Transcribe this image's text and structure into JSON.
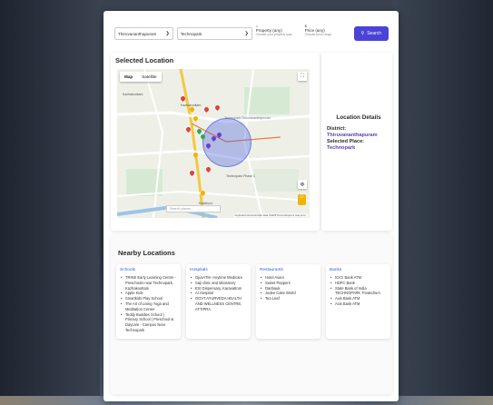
{
  "search": {
    "district": "Thiruvananthapuram",
    "place": "Technopark",
    "property_title": "Property (any)",
    "property_hint": "Choose your property type",
    "price_title": "Price (any)",
    "price_hint": "Choose price range",
    "search_label": "Search"
  },
  "map_section": {
    "title": "Selected Location",
    "tabs": [
      "Map",
      "Satellite"
    ],
    "search_placeholder": "Search places...",
    "footer": "Keyboard shortcuts  Map data ©2025  Terms  Report a map error",
    "labels": [
      "Kazhakoottam",
      "Technopark Thiruvananthapuram",
      "Technopark Phase 1",
      "Kulathoor",
      "Kazhakoottam"
    ]
  },
  "details": {
    "title": "Location Details",
    "district_label": "District:",
    "district_value": "Thiruvananthapuram",
    "place_label": "Selected Place:",
    "place_value": "Technopark"
  },
  "nearby": {
    "title": "Nearby Locations",
    "columns": [
      {
        "title": "Schools",
        "items": [
          "TRINS Early Learning Centre - Preschools near Technopark, Kazhakoottam",
          "Apple Kids",
          "Smartkids Play School",
          "The Art of Living Yoga and Meditation Center",
          "Teddy Buddies School | Primary School | Preschool & Daycare - Campus Near Technopark"
        ]
      },
      {
        "title": "Hospitals",
        "items": [
          "OjusATM -Anytime Medicare",
          "Saji clinic and laboratory",
          "ESI Dispensary, Karavattom",
          "AI Hospital",
          "GOVT.AYURVEDA HEALTH AND WELLNESS CENTRE, ATTIPRA"
        ]
      },
      {
        "title": "Restaurants",
        "items": [
          "Hotel Avani",
          "Sweet Peppers",
          "Danbauk",
          "Jodee Cake World",
          "Tea Leaf"
        ]
      },
      {
        "title": "Banks",
        "items": [
          "ICICI Bank ATM",
          "HDFC Bank",
          "State Bank of India TECHNOPARK Trivandrum",
          "Axis Bank ATM",
          "Axis Bank ATM"
        ]
      }
    ]
  },
  "colors": {
    "accent": "#4a43d6",
    "link": "#2b5fd6",
    "value": "#5a3fb0"
  }
}
